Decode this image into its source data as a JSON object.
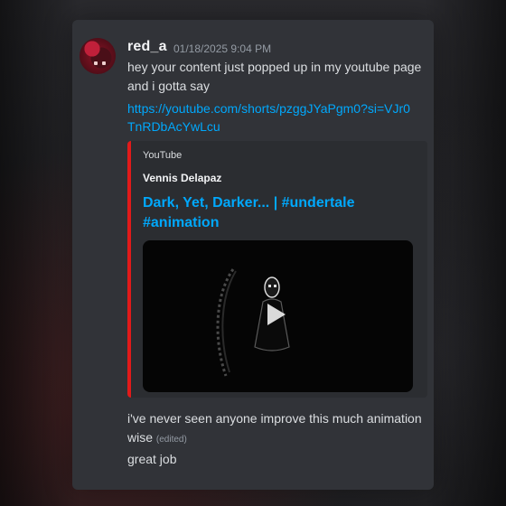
{
  "message": {
    "username": "red_a",
    "timestamp": "01/18/2025 9:04 PM",
    "line1": "hey your content just popped up in my youtube page",
    "line2": "and i gotta say",
    "link": "https://youtube.com/shorts/pzggJYaPgm0?si=VJr0TnRDbAcYwLcu"
  },
  "embed": {
    "provider": "YouTube",
    "author": "Vennis Delapaz",
    "title": "Dark, Yet, Darker... | #undertale #animation",
    "accent_color": "#e21a1a",
    "play_icon": "play-icon"
  },
  "followup": {
    "line1": "i've never seen anyone improve this much animation",
    "line2": "wise",
    "edited": "(edited)",
    "line3": "great job"
  },
  "colors": {
    "link": "#00a8fc",
    "background": "#313338",
    "text": "#dbdee1",
    "muted": "#949ba4"
  }
}
